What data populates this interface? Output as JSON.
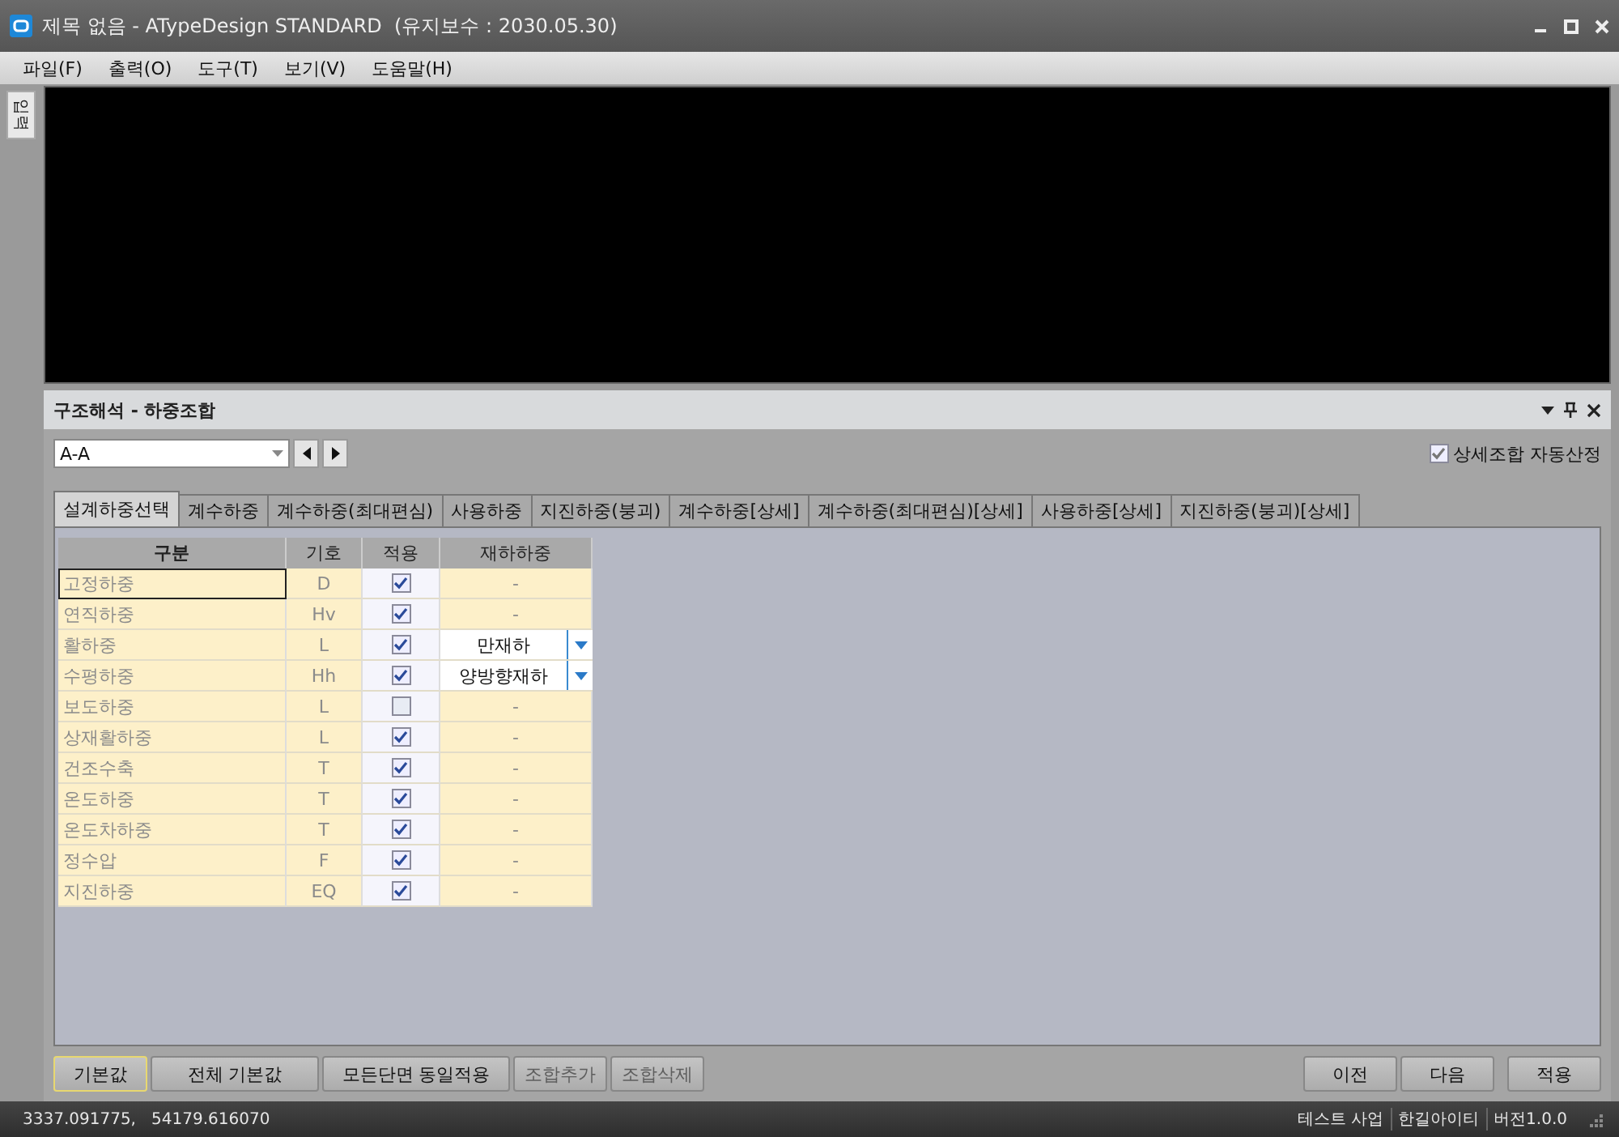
{
  "window": {
    "title": "제목 없음 - ATypeDesign STANDARD  (유지보수 : 2030.05.30)"
  },
  "menu": [
    "파일(F)",
    "출력(O)",
    "도구(T)",
    "보기(V)",
    "도움말(H)"
  ],
  "side_tab": {
    "label": "입력"
  },
  "panel": {
    "title": "구조해석 - 하중조합",
    "section": {
      "value": "A-A"
    },
    "auto_detail": {
      "label": "상세조합 자동산정",
      "checked": true
    },
    "tabs": [
      {
        "label": "설계하중선택",
        "selected": true
      },
      {
        "label": "계수하중",
        "selected": false
      },
      {
        "label": "계수하중(최대편심)",
        "selected": false
      },
      {
        "label": "사용하중",
        "selected": false
      },
      {
        "label": "지진하중(붕괴)",
        "selected": false
      },
      {
        "label": "계수하중[상세]",
        "selected": false
      },
      {
        "label": "계수하중(최대편심)[상세]",
        "selected": false
      },
      {
        "label": "사용하중[상세]",
        "selected": false
      },
      {
        "label": "지진하중(붕괴)[상세]",
        "selected": false
      }
    ],
    "table": {
      "columns": [
        "구분",
        "기호",
        "적용",
        "재하하중"
      ],
      "rows": [
        {
          "name": "고정하중",
          "symbol": "D",
          "applied": true,
          "selected": true,
          "load": {
            "kind": "text",
            "value": "-"
          }
        },
        {
          "name": "연직하중",
          "symbol": "Hv",
          "applied": true,
          "selected": false,
          "load": {
            "kind": "text",
            "value": "-"
          }
        },
        {
          "name": "활하중",
          "symbol": "L",
          "applied": true,
          "selected": false,
          "load": {
            "kind": "dropdown",
            "value": "만재하"
          }
        },
        {
          "name": "수평하중",
          "symbol": "Hh",
          "applied": true,
          "selected": false,
          "load": {
            "kind": "dropdown",
            "value": "양방향재하"
          }
        },
        {
          "name": "보도하중",
          "symbol": "L",
          "applied": false,
          "selected": false,
          "load": {
            "kind": "text",
            "value": "-"
          }
        },
        {
          "name": "상재활하중",
          "symbol": "L",
          "applied": true,
          "selected": false,
          "load": {
            "kind": "text",
            "value": "-"
          }
        },
        {
          "name": "건조수축",
          "symbol": "T",
          "applied": true,
          "selected": false,
          "load": {
            "kind": "text",
            "value": "-"
          }
        },
        {
          "name": "온도하중",
          "symbol": "T",
          "applied": true,
          "selected": false,
          "load": {
            "kind": "text",
            "value": "-"
          }
        },
        {
          "name": "온도차하중",
          "symbol": "T",
          "applied": true,
          "selected": false,
          "load": {
            "kind": "text",
            "value": "-"
          }
        },
        {
          "name": "정수압",
          "symbol": "F",
          "applied": true,
          "selected": false,
          "load": {
            "kind": "text",
            "value": "-"
          }
        },
        {
          "name": "지진하중",
          "symbol": "EQ",
          "applied": true,
          "selected": false,
          "load": {
            "kind": "text",
            "value": "-"
          }
        }
      ]
    },
    "left_buttons": [
      {
        "label": "기본값",
        "disabled": false,
        "selected": true
      },
      {
        "label": "전체 기본값",
        "disabled": false,
        "selected": false
      },
      {
        "label": "모든단면 동일적용",
        "disabled": false,
        "selected": false
      },
      {
        "label": "조합추가",
        "disabled": true,
        "selected": false
      },
      {
        "label": "조합삭제",
        "disabled": true,
        "selected": false
      }
    ],
    "right_buttons": [
      "이전",
      "다음",
      "적용"
    ]
  },
  "status_bar": {
    "coordinates": "3337.091775,   54179.616070",
    "items": [
      "테스트 사업",
      "한길아이티",
      "버전1.0.0"
    ]
  }
}
